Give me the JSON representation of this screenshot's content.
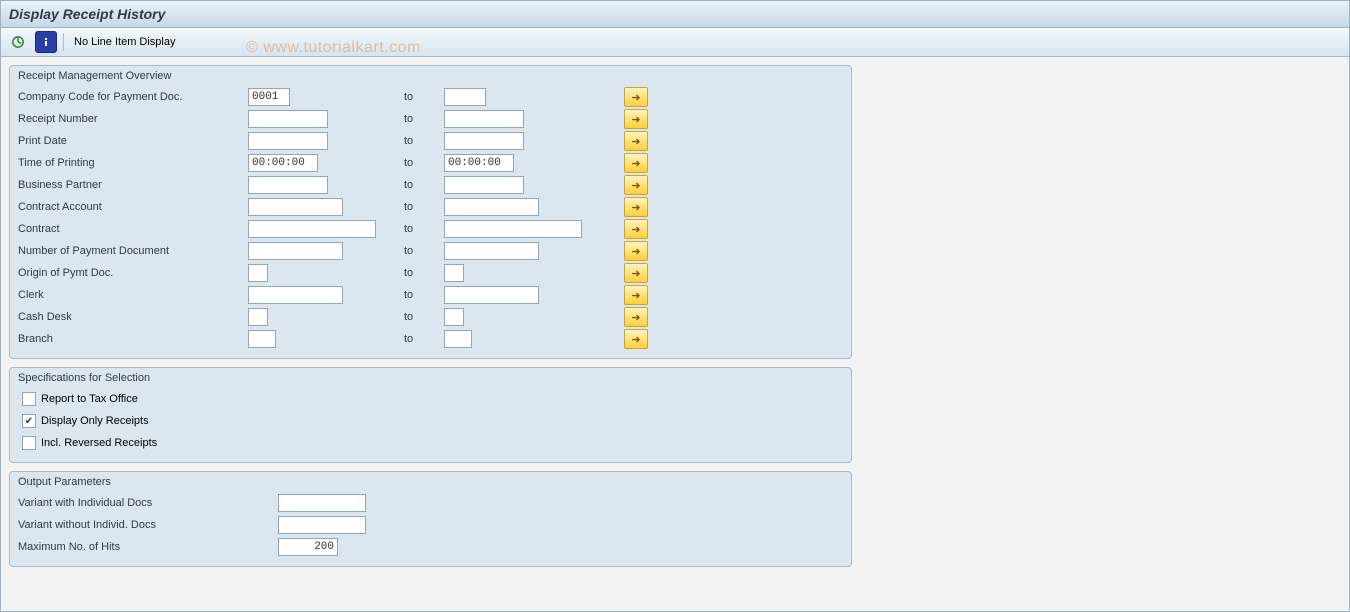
{
  "title": "Display Receipt History",
  "toolbar": {
    "no_line_item": "No Line Item Display"
  },
  "watermark": "©  www.tutorialkart.com",
  "group1": {
    "title": "Receipt Management Overview",
    "rows": {
      "company_code": {
        "label": "Company Code for Payment Doc.",
        "from": "0001",
        "to": "",
        "to_label": "to"
      },
      "receipt_number": {
        "label": "Receipt Number",
        "from": "",
        "to": "",
        "to_label": "to"
      },
      "print_date": {
        "label": "Print Date",
        "from": "",
        "to": "",
        "to_label": "to"
      },
      "time_of_printing": {
        "label": "Time of Printing",
        "from": "00:00:00",
        "to": "00:00:00",
        "to_label": "to"
      },
      "business_partner": {
        "label": "Business Partner",
        "from": "",
        "to": "",
        "to_label": "to"
      },
      "contract_account": {
        "label": "Contract Account",
        "from": "",
        "to": "",
        "to_label": "to"
      },
      "contract": {
        "label": "Contract",
        "from": "",
        "to": "",
        "to_label": "to"
      },
      "num_payment_doc": {
        "label": "Number of Payment Document",
        "from": "",
        "to": "",
        "to_label": "to"
      },
      "origin_pymt_doc": {
        "label": "Origin of Pymt Doc.",
        "from": "",
        "to": "",
        "to_label": "to"
      },
      "clerk": {
        "label": "Clerk",
        "from": "",
        "to": "",
        "to_label": "to"
      },
      "cash_desk": {
        "label": "Cash Desk",
        "from": "",
        "to": "",
        "to_label": "to"
      },
      "branch": {
        "label": "Branch",
        "from": "",
        "to": "",
        "to_label": "to"
      }
    }
  },
  "group2": {
    "title": "Specifications for Selection",
    "checks": {
      "report_tax": {
        "label": "Report to Tax Office",
        "checked": false
      },
      "only_receipts": {
        "label": "Display Only Receipts",
        "checked": true
      },
      "incl_reversed": {
        "label": "Incl. Reversed Receipts",
        "checked": false
      }
    }
  },
  "group3": {
    "title": "Output Parameters",
    "variant_with": {
      "label": "Variant with Individual Docs",
      "value": ""
    },
    "variant_without": {
      "label": "Variant without Individ. Docs",
      "value": ""
    },
    "max_hits": {
      "label": "Maximum No. of Hits",
      "value": "200"
    }
  }
}
